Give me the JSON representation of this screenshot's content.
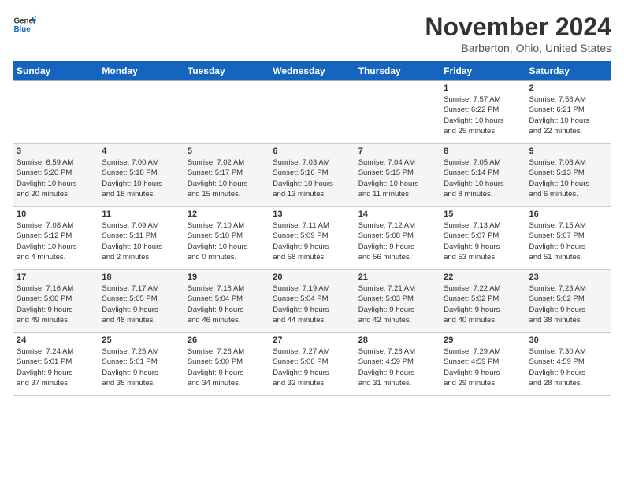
{
  "logo": {
    "text_general": "General",
    "text_blue": "Blue"
  },
  "title": "November 2024",
  "subtitle": "Barberton, Ohio, United States",
  "headers": [
    "Sunday",
    "Monday",
    "Tuesday",
    "Wednesday",
    "Thursday",
    "Friday",
    "Saturday"
  ],
  "weeks": [
    [
      {
        "day": "",
        "info": ""
      },
      {
        "day": "",
        "info": ""
      },
      {
        "day": "",
        "info": ""
      },
      {
        "day": "",
        "info": ""
      },
      {
        "day": "",
        "info": ""
      },
      {
        "day": "1",
        "info": "Sunrise: 7:57 AM\nSunset: 6:22 PM\nDaylight: 10 hours\nand 25 minutes."
      },
      {
        "day": "2",
        "info": "Sunrise: 7:58 AM\nSunset: 6:21 PM\nDaylight: 10 hours\nand 22 minutes."
      }
    ],
    [
      {
        "day": "3",
        "info": "Sunrise: 6:59 AM\nSunset: 5:20 PM\nDaylight: 10 hours\nand 20 minutes."
      },
      {
        "day": "4",
        "info": "Sunrise: 7:00 AM\nSunset: 5:18 PM\nDaylight: 10 hours\nand 18 minutes."
      },
      {
        "day": "5",
        "info": "Sunrise: 7:02 AM\nSunset: 5:17 PM\nDaylight: 10 hours\nand 15 minutes."
      },
      {
        "day": "6",
        "info": "Sunrise: 7:03 AM\nSunset: 5:16 PM\nDaylight: 10 hours\nand 13 minutes."
      },
      {
        "day": "7",
        "info": "Sunrise: 7:04 AM\nSunset: 5:15 PM\nDaylight: 10 hours\nand 11 minutes."
      },
      {
        "day": "8",
        "info": "Sunrise: 7:05 AM\nSunset: 5:14 PM\nDaylight: 10 hours\nand 8 minutes."
      },
      {
        "day": "9",
        "info": "Sunrise: 7:06 AM\nSunset: 5:13 PM\nDaylight: 10 hours\nand 6 minutes."
      }
    ],
    [
      {
        "day": "10",
        "info": "Sunrise: 7:08 AM\nSunset: 5:12 PM\nDaylight: 10 hours\nand 4 minutes."
      },
      {
        "day": "11",
        "info": "Sunrise: 7:09 AM\nSunset: 5:11 PM\nDaylight: 10 hours\nand 2 minutes."
      },
      {
        "day": "12",
        "info": "Sunrise: 7:10 AM\nSunset: 5:10 PM\nDaylight: 10 hours\nand 0 minutes."
      },
      {
        "day": "13",
        "info": "Sunrise: 7:11 AM\nSunset: 5:09 PM\nDaylight: 9 hours\nand 58 minutes."
      },
      {
        "day": "14",
        "info": "Sunrise: 7:12 AM\nSunset: 5:08 PM\nDaylight: 9 hours\nand 56 minutes."
      },
      {
        "day": "15",
        "info": "Sunrise: 7:13 AM\nSunset: 5:07 PM\nDaylight: 9 hours\nand 53 minutes."
      },
      {
        "day": "16",
        "info": "Sunrise: 7:15 AM\nSunset: 5:07 PM\nDaylight: 9 hours\nand 51 minutes."
      }
    ],
    [
      {
        "day": "17",
        "info": "Sunrise: 7:16 AM\nSunset: 5:06 PM\nDaylight: 9 hours\nand 49 minutes."
      },
      {
        "day": "18",
        "info": "Sunrise: 7:17 AM\nSunset: 5:05 PM\nDaylight: 9 hours\nand 48 minutes."
      },
      {
        "day": "19",
        "info": "Sunrise: 7:18 AM\nSunset: 5:04 PM\nDaylight: 9 hours\nand 46 minutes."
      },
      {
        "day": "20",
        "info": "Sunrise: 7:19 AM\nSunset: 5:04 PM\nDaylight: 9 hours\nand 44 minutes."
      },
      {
        "day": "21",
        "info": "Sunrise: 7:21 AM\nSunset: 5:03 PM\nDaylight: 9 hours\nand 42 minutes."
      },
      {
        "day": "22",
        "info": "Sunrise: 7:22 AM\nSunset: 5:02 PM\nDaylight: 9 hours\nand 40 minutes."
      },
      {
        "day": "23",
        "info": "Sunrise: 7:23 AM\nSunset: 5:02 PM\nDaylight: 9 hours\nand 38 minutes."
      }
    ],
    [
      {
        "day": "24",
        "info": "Sunrise: 7:24 AM\nSunset: 5:01 PM\nDaylight: 9 hours\nand 37 minutes."
      },
      {
        "day": "25",
        "info": "Sunrise: 7:25 AM\nSunset: 5:01 PM\nDaylight: 9 hours\nand 35 minutes."
      },
      {
        "day": "26",
        "info": "Sunrise: 7:26 AM\nSunset: 5:00 PM\nDaylight: 9 hours\nand 34 minutes."
      },
      {
        "day": "27",
        "info": "Sunrise: 7:27 AM\nSunset: 5:00 PM\nDaylight: 9 hours\nand 32 minutes."
      },
      {
        "day": "28",
        "info": "Sunrise: 7:28 AM\nSunset: 4:59 PM\nDaylight: 9 hours\nand 31 minutes."
      },
      {
        "day": "29",
        "info": "Sunrise: 7:29 AM\nSunset: 4:59 PM\nDaylight: 9 hours\nand 29 minutes."
      },
      {
        "day": "30",
        "info": "Sunrise: 7:30 AM\nSunset: 4:59 PM\nDaylight: 9 hours\nand 28 minutes."
      }
    ]
  ]
}
